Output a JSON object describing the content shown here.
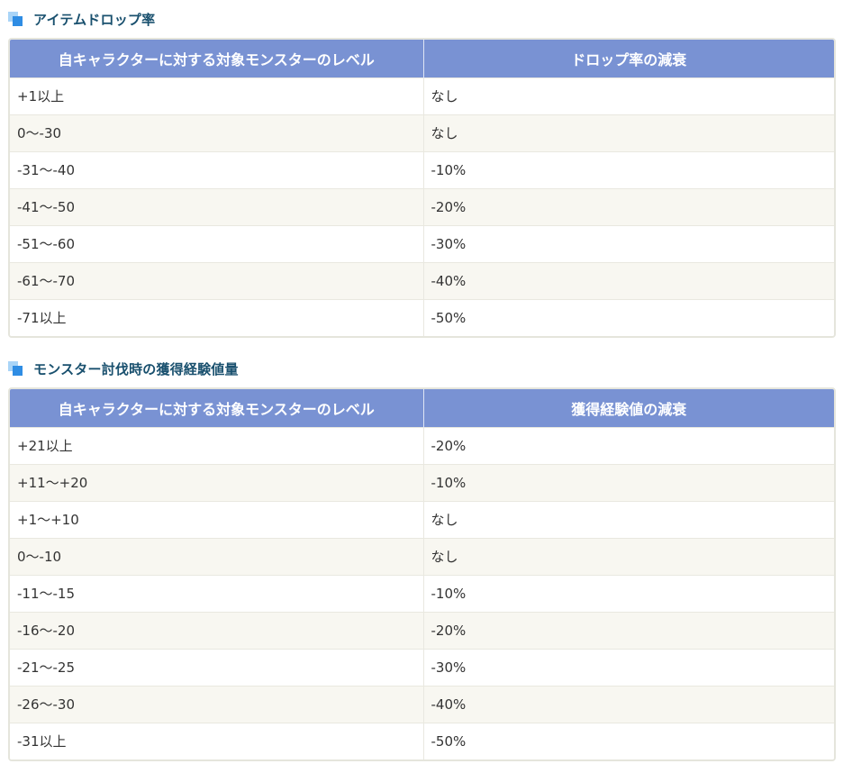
{
  "sections": [
    {
      "title": "アイテムドロップ率",
      "headers": [
        "自キャラクターに対する対象モンスターのレベル",
        "ドロップ率の減衰"
      ],
      "rows": [
        [
          "+1以上",
          "なし"
        ],
        [
          "0〜-30",
          "なし"
        ],
        [
          "-31〜-40",
          "-10%"
        ],
        [
          "-41〜-50",
          "-20%"
        ],
        [
          "-51〜-60",
          "-30%"
        ],
        [
          "-61〜-70",
          "-40%"
        ],
        [
          "-71以上",
          "-50%"
        ]
      ]
    },
    {
      "title": "モンスター討伐時の獲得経験値量",
      "headers": [
        "自キャラクターに対する対象モンスターのレベル",
        "獲得経験値の減衰"
      ],
      "rows": [
        [
          "+21以上",
          "-20%"
        ],
        [
          "+11〜+20",
          "-10%"
        ],
        [
          "+1〜+10",
          "なし"
        ],
        [
          "0〜-10",
          "なし"
        ],
        [
          "-11〜-15",
          "-10%"
        ],
        [
          "-16〜-20",
          "-20%"
        ],
        [
          "-21〜-25",
          "-30%"
        ],
        [
          "-26〜-30",
          "-40%"
        ],
        [
          "-31以上",
          "-50%"
        ]
      ]
    }
  ],
  "colors": {
    "header_bg": "#7992d3",
    "title_text": "#19506e",
    "row_alt_bg": "#f8f7f1",
    "icon_light": "#a9d4f7",
    "icon_dark": "#2f8de4"
  },
  "icons": {
    "section_title": "stacked-squares-icon"
  }
}
